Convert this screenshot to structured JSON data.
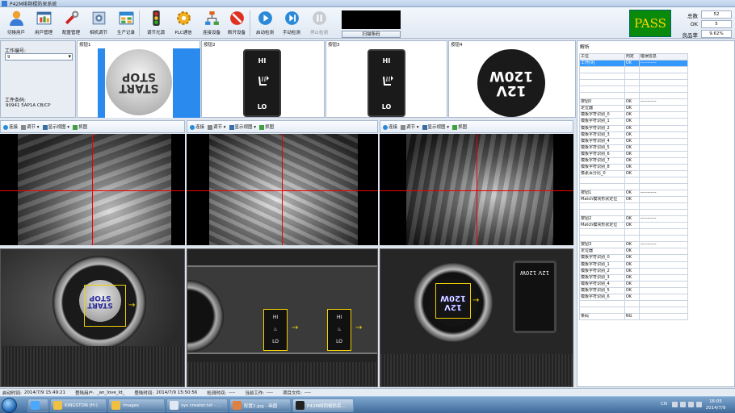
{
  "window": {
    "title": "P42M绯荆棍防呆系統"
  },
  "toolbar": {
    "buttons": [
      {
        "label": "切換用戶"
      },
      {
        "label": "用戶管理"
      },
      {
        "label": "配置管理"
      },
      {
        "label": "相机调节"
      },
      {
        "label": "生产记录"
      },
      {
        "label": "调节光源"
      },
      {
        "label": "PLC通信"
      },
      {
        "label": "连接设备"
      },
      {
        "label": "断开设备"
      },
      {
        "label": "启动检测"
      },
      {
        "label": "手动检测"
      },
      {
        "label": "停止检测"
      }
    ],
    "scan_label": "扫描条码"
  },
  "result": {
    "status": "PASS",
    "pass_color": "#0a8a0a",
    "text_color": "#ffd700"
  },
  "stats": [
    {
      "label": "总数",
      "value": "52"
    },
    {
      "label": "OK",
      "value": "5"
    },
    {
      "label": "良品率",
      "value": "9.62%"
    }
  ],
  "left_panel": {
    "work_no_label": "工作编号:",
    "work_no_value": "9",
    "barcode_label": "工件条码:",
    "barcode_value": "90941 5AP1A CB/CP"
  },
  "stations": [
    {
      "label": "按钮1",
      "image": "START STOP"
    },
    {
      "label": "按钮2",
      "image_top": "HI",
      "image_bottom": "LO"
    },
    {
      "label": "按钮3",
      "image_top": "HI",
      "image_bottom": "LO"
    },
    {
      "label": "按钮4",
      "image": "12V 120W"
    }
  ],
  "camera_toolbar": {
    "connect": "连接",
    "adjust": "调节",
    "view": "显示视图",
    "capture": "抓图"
  },
  "right_panel": {
    "title": "解析",
    "headers": [
      "工位",
      "判定",
      "错误信息"
    ],
    "rows": [
      [
        "工作[9]",
        "OK",
        "-----------"
      ],
      [
        "",
        "",
        ""
      ],
      [
        "",
        "",
        ""
      ],
      [
        "",
        "",
        ""
      ],
      [
        "",
        "",
        ""
      ],
      [
        "",
        "",
        ""
      ],
      [
        "按钮0",
        "OK",
        "-----------"
      ],
      [
        "定位器",
        "OK",
        ""
      ],
      [
        "模板字符识别_0",
        "OK",
        ""
      ],
      [
        "模板字符识别_1",
        "OK",
        ""
      ],
      [
        "模板字符识别_2",
        "OK",
        ""
      ],
      [
        "模板字符识别_3",
        "OK",
        ""
      ],
      [
        "模板字符识别_4",
        "OK",
        ""
      ],
      [
        "模板字符识别_5",
        "OK",
        ""
      ],
      [
        "模板字符识别_6",
        "OK",
        ""
      ],
      [
        "模板字符识别_7",
        "OK",
        ""
      ],
      [
        "模板字符识别_8",
        "OK",
        ""
      ],
      [
        "像素百分比_0",
        "OK",
        ""
      ],
      [
        "",
        "",
        ""
      ],
      [
        "",
        "",
        ""
      ],
      [
        "按钮1",
        "OK",
        "-----------"
      ],
      [
        "Match模块形状定位",
        "OK",
        ""
      ],
      [
        "",
        "",
        ""
      ],
      [
        "",
        "",
        ""
      ],
      [
        "按钮2",
        "OK",
        "-----------"
      ],
      [
        "Match模块形状定位",
        "OK",
        ""
      ],
      [
        "",
        "",
        ""
      ],
      [
        "",
        "",
        ""
      ],
      [
        "按钮3",
        "OK",
        "-----------"
      ],
      [
        "定位器",
        "OK",
        ""
      ],
      [
        "模板字符识别_0",
        "OK",
        ""
      ],
      [
        "模板字符识别_1",
        "OK",
        ""
      ],
      [
        "模板字符识别_2",
        "OK",
        ""
      ],
      [
        "模板字符识别_3",
        "OK",
        ""
      ],
      [
        "模板字符识别_4",
        "OK",
        ""
      ],
      [
        "模板字符识别_5",
        "OK",
        ""
      ],
      [
        "模板字符识别_6",
        "OK",
        ""
      ],
      [
        "",
        "",
        ""
      ],
      [
        "",
        "",
        ""
      ],
      [
        "条码",
        "NG",
        ""
      ]
    ]
  },
  "statusbar": {
    "start_label": "启动时间:",
    "start_value": "2014/7/9 15:49:21",
    "user_label": "登陆用户:",
    "user_value": "_an_love_Id_",
    "login_label": "登陆时间:",
    "login_value": "2014/7/9 15:50:56",
    "test_label": "检测时间:",
    "test_value": "----",
    "current_label": "当前工作:",
    "current_value": "----",
    "file_label": "项目文件:",
    "file_value": "----"
  },
  "taskbar": {
    "items": [
      {
        "label": "KINGSTON (H:)"
      },
      {
        "label": "images"
      },
      {
        "label": "sys creator.txt - ..."
      },
      {
        "label": "配置2.jpg - 画图"
      },
      {
        "label": "P42M绯荆棍防呆..."
      }
    ],
    "lang": "CN",
    "time": "16:05",
    "date": "2014/7/9"
  }
}
